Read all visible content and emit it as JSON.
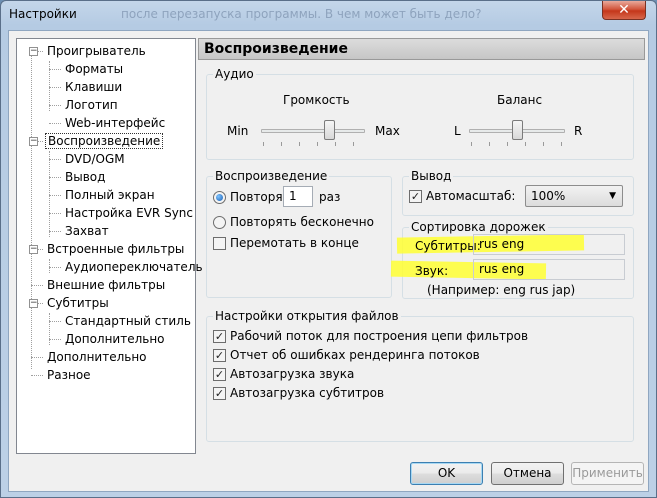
{
  "window": {
    "title": "Настройки",
    "background_text": "после перезапуска программы. В чем может быть дело?"
  },
  "tree": {
    "items": [
      {
        "label": "Проигрыватель",
        "expander": "−"
      },
      {
        "label": "Форматы"
      },
      {
        "label": "Клавиши"
      },
      {
        "label": "Логотип"
      },
      {
        "label": "Web-интерфейс"
      },
      {
        "label": "Воспроизведение",
        "expander": "−",
        "selected": true
      },
      {
        "label": "DVD/OGM"
      },
      {
        "label": "Вывод"
      },
      {
        "label": "Полный экран"
      },
      {
        "label": "Настройка EVR Sync"
      },
      {
        "label": "Захват"
      },
      {
        "label": "Встроенные фильтры",
        "expander": "−"
      },
      {
        "label": "Аудиопереключатель"
      },
      {
        "label": "Внешние фильтры"
      },
      {
        "label": "Субтитры",
        "expander": "−"
      },
      {
        "label": "Стандартный стиль"
      },
      {
        "label": "Дополнительно"
      },
      {
        "label": "Дополнительно"
      },
      {
        "label": "Разное"
      }
    ]
  },
  "panel": {
    "header": "Воспроизведение",
    "audio": {
      "legend": "Аудио",
      "volume_label": "Громкость",
      "volume_min": "Min",
      "volume_max": "Max",
      "volume_level": 0.65,
      "balance_label": "Баланс",
      "balance_left": "L",
      "balance_right": "R",
      "balance_level": 0.5
    },
    "playback": {
      "legend": "Воспроизведение",
      "repeat_label": "Повторя",
      "repeat_count": "1",
      "repeat_suffix": "раз",
      "repeat_forever_label": "Повторять бесконечно",
      "rewind_label": "Перемотать в конце",
      "selected_mode": "repeat"
    },
    "output": {
      "legend": "Вывод",
      "autozoom_label": "Автомасштаб:",
      "autozoom_checked": true,
      "zoom_value": "100%"
    },
    "track_order": {
      "legend": "Сортировка дорожек",
      "subtitles_label": "Субтитры:",
      "subtitles_value": "rus eng",
      "audio_label": "Звук:",
      "audio_value": "rus eng",
      "example": "(Например: eng rus jap)",
      "highlight_color": "#ffff33"
    },
    "file_open": {
      "legend": "Настройки открытия файлов",
      "options": [
        {
          "label": "Рабочий поток для построения цепи фильтров",
          "checked": true
        },
        {
          "label": "Отчет об ошибках рендеринга потоков",
          "checked": true
        },
        {
          "label": "Автозагрузка звука",
          "checked": true
        },
        {
          "label": "Автозагрузка субтитров",
          "checked": true
        }
      ]
    }
  },
  "buttons": {
    "ok": "OK",
    "cancel": "Отмена",
    "apply": "Применить"
  },
  "colors": {
    "title_gradient_top": "#c4d6ea",
    "close_button": "#c5371b",
    "default_button_border": "#3c7fb1"
  }
}
